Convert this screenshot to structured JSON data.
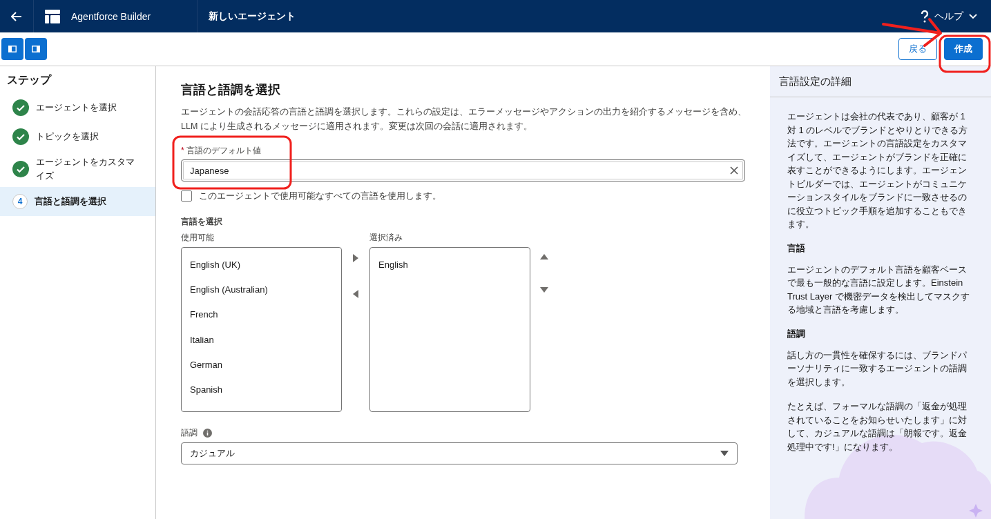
{
  "header": {
    "app_name": "Agentforce Builder",
    "page_title": "新しいエージェント",
    "help_label": "ヘルプ"
  },
  "toolbar": {
    "buttons": [
      {
        "label": "戻る",
        "kind": "neutral"
      },
      {
        "label": "作成",
        "kind": "brand"
      }
    ]
  },
  "steps": {
    "title": "ステップ",
    "items": [
      {
        "label": "エージェントを選択",
        "completed": true,
        "selected": false
      },
      {
        "label": "トピックを選択",
        "completed": true,
        "selected": false
      },
      {
        "label": "エージェントをカスタマイズ",
        "completed": true,
        "selected": false
      },
      {
        "label": "言語と語調を選択",
        "completed": false,
        "number": "4",
        "selected": true
      }
    ]
  },
  "main": {
    "title": "言語と語調を選択",
    "description": "エージェントの会話応答の言語と語調を選択します。これらの設定は、エラーメッセージやアクションの出力を紹介するメッセージを含め、LLM により生成されるメッセージに適用されます。変更は次回の会話に適用されます。",
    "default_language": {
      "label": "言語のデフォルト値",
      "required_mark": "*",
      "value": "Japanese"
    },
    "use_all_checkbox": {
      "label": "このエージェントで使用可能なすべての言語を使用します。",
      "checked": false
    },
    "language_picker": {
      "title": "言語を選択",
      "available_label": "使用可能",
      "selected_label": "選択済み",
      "available": [
        "English (UK)",
        "English (Australian)",
        "French",
        "Italian",
        "German",
        "Spanish"
      ],
      "selected": [
        "English"
      ]
    },
    "tone": {
      "label": "語調",
      "value": "カジュアル"
    }
  },
  "help_panel": {
    "title": "言語設定の詳細",
    "sections": [
      {
        "paragraphs": [
          "エージェントは会社の代表であり、顧客が 1 対 1 のレベルでブランドとやりとりできる方法です。エージェントの言語設定をカスタマイズして、エージェントがブランドを正確に表すことができるようにします。エージェントビルダーでは、エージェントがコミュニケーションスタイルをブランドに一致させるのに役立つトピック手順を追加することもできます。"
        ]
      },
      {
        "heading": "言語",
        "paragraphs": [
          "エージェントのデフォルト言語を顧客ベースで最も一般的な言語に設定します。Einstein Trust Layer で機密データを検出してマスクする地域と言語を考慮します。"
        ]
      },
      {
        "heading": "語調",
        "paragraphs": [
          "話し方の一貫性を確保するには、ブランドパーソナリティに一致するエージェントの語調を選択します。",
          "たとえば、フォーマルな語調の「返金が処理されていることをお知らせいたします」に対して、カジュアルな語調は「朗報です。返金処理中です!」になります。"
        ]
      }
    ]
  }
}
